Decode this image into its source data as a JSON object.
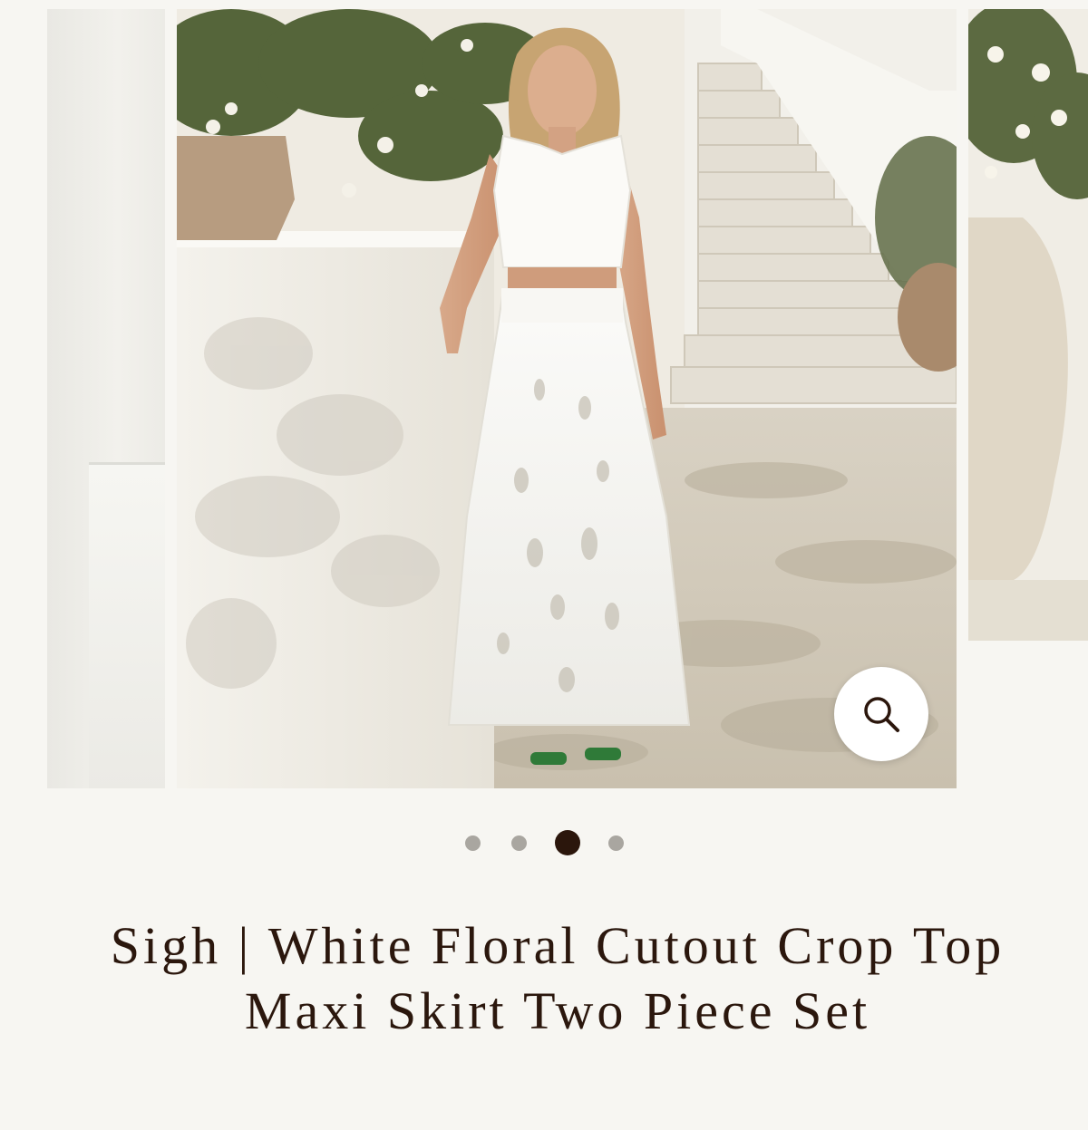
{
  "product": {
    "title": "Sigh | White Floral Cutout Crop Top Maxi Skirt Two Piece Set"
  },
  "gallery": {
    "slide_count": 4,
    "active_slide": 3,
    "zoom_icon": "search-icon"
  },
  "colors": {
    "background": "#f7f6f2",
    "title_text": "#2b170d",
    "dot_active": "#2b160c",
    "dot_inactive": "#a9a6a0",
    "zoom_button_bg": "#ffffff"
  }
}
